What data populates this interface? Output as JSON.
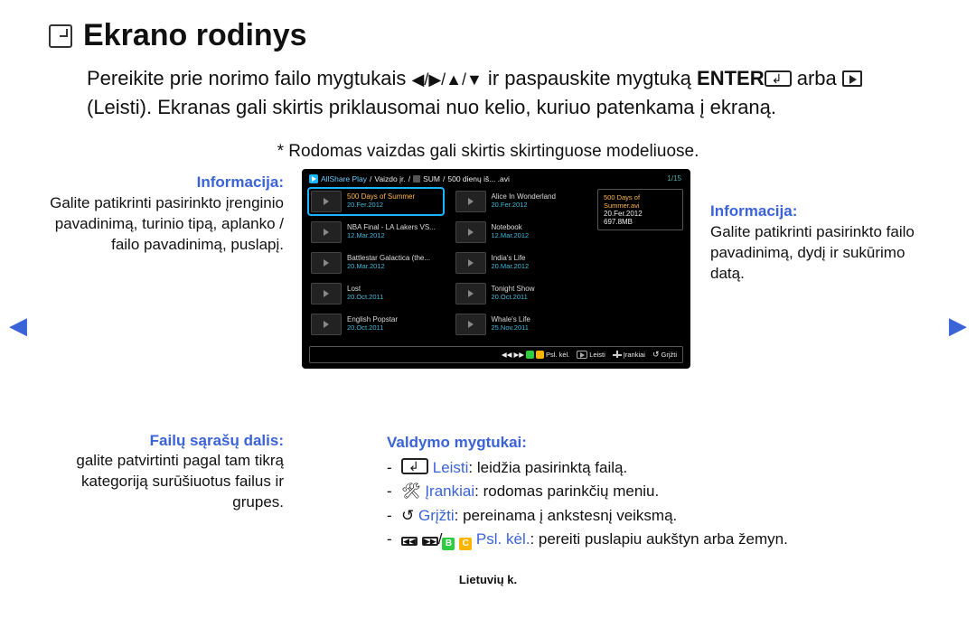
{
  "title": "Ekrano rodinys",
  "intro": {
    "p1a": "Pereikite prie norimo failo mygtukais ",
    "arrows": "◀/▶/▲/▼",
    "p1b": " ir paspauskite mygtuką ",
    "enter": "ENTER",
    "p2a": " arba ",
    "play_label": " (Leisti). Ekranas gali skirtis priklausomai nuo kelio, kuriuo patenkama į ekraną."
  },
  "note": "* Rodomas vaizdas gali skirtis skirtinguose modeliuose.",
  "left": {
    "info_label": "Informacija:",
    "info_text": "Galite patikrinti pasirinkto įrenginio pavadinimą, turinio tipą, aplanko / failo pavadinimą, puslapį.",
    "files_label": "Failų sąrašų dalis:",
    "files_text": "galite patvirtinti pagal tam tikrą kategoriją surūšiuotus failus ir grupes."
  },
  "right": {
    "info_label": "Informacija:",
    "info_text": "Galite patikrinti pasirinkto failo pavadinimą, dydį ir sukūrimo datą."
  },
  "controls": {
    "label": "Valdymo mygtukai:",
    "play": {
      "cmd": "Leisti",
      "txt": ": leidžia pasirinktą failą."
    },
    "tools": {
      "cmd": "Įrankiai",
      "txt": ": rodomas parinkčių meniu."
    },
    "return": {
      "cmd": "Grįžti",
      "txt": ": pereinama į ankstesnį veiksmą."
    },
    "page": {
      "b": "B",
      "c": "C",
      "cmd": " Psl. kėl.",
      "txt": ": pereiti puslapiu aukštyn arba žemyn."
    }
  },
  "tv": {
    "crumb": {
      "app": "AllShare Play",
      "sep1": " / ",
      "a": "Vaizdo įr.",
      "sep2": " / ",
      "dev": "SUM",
      "sep3": " / ",
      "file": "500 dienų iš... .avi"
    },
    "page": "1/15",
    "col1": [
      {
        "t": "500 Days of Summer",
        "d": "20.Fer.2012",
        "sel": true
      },
      {
        "t": "NBA Final - LA Lakers VS...",
        "d": "12.Mar.2012"
      },
      {
        "t": "Battlestar Galactica (the...",
        "d": "20.Mar.2012"
      },
      {
        "t": "Lost",
        "d": "20.Oct.2011"
      },
      {
        "t": "English Popstar",
        "d": "20.Oct.2011"
      }
    ],
    "col2": [
      {
        "t": "Alice In Wonderland",
        "d": "20.Fer.2012"
      },
      {
        "t": "Notebook",
        "d": "12.Mar.2012"
      },
      {
        "t": "India's Life",
        "d": "20.Mar.2012"
      },
      {
        "t": "Tonight Show",
        "d": "20.Oct.2011"
      },
      {
        "t": "Whale's Life",
        "d": "25.Nov.2011"
      }
    ],
    "info": {
      "title": "500 Days of Summer.avi",
      "date": "20.Fer.2012",
      "size": "697.8MB"
    },
    "bar": {
      "page": "Psl. kėl.",
      "play": "Leisti",
      "tools": "Įrankiai",
      "return": "Grįžti"
    }
  },
  "footer": "Lietuvių k."
}
